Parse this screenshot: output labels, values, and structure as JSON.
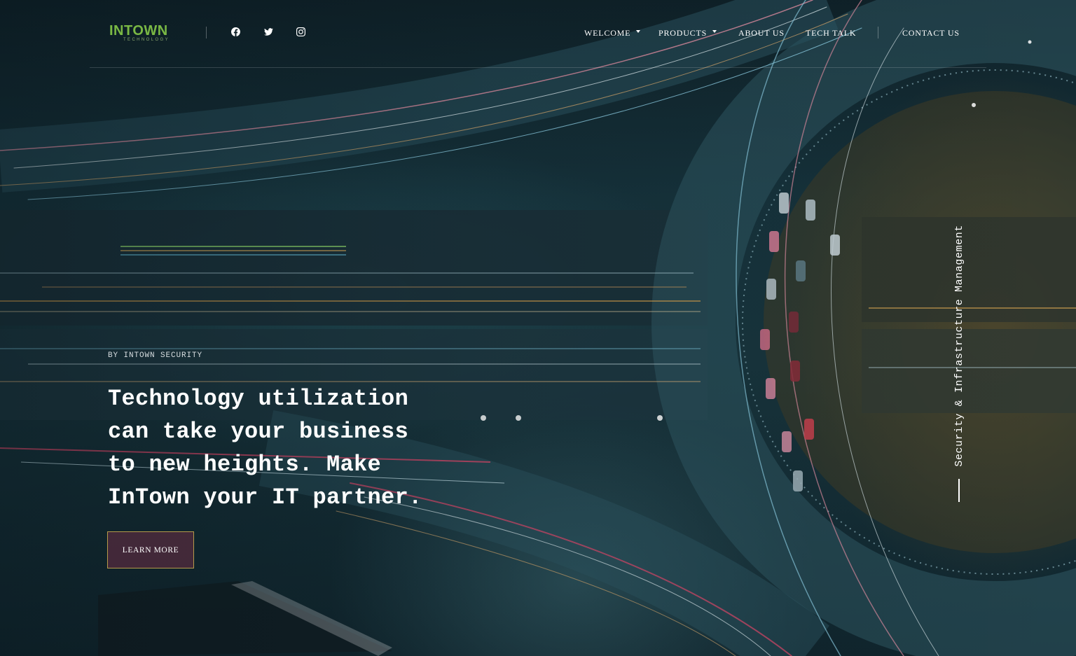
{
  "header": {
    "logo": {
      "word": "INTOWN",
      "sub": "TECHNOLOGY"
    },
    "social": [
      {
        "icon": "facebook-icon"
      },
      {
        "icon": "twitter-icon"
      },
      {
        "icon": "instagram-icon"
      }
    ],
    "nav": {
      "welcome": "WELCOME",
      "products": "PRODUCTS",
      "about": "ABOUT US",
      "tech_talk": "TECH TALK",
      "contact": "CONTACT US"
    }
  },
  "hero": {
    "eyebrow": "BY INTOWN SECURITY",
    "headline": "Technology utilization can take your business to new heights. Make InTown your IT partner.",
    "cta": "LEARN MORE",
    "side_tag": "Security & Infrastructure Management"
  },
  "colors": {
    "logo_green": "#7ab844",
    "cta_border": "#b59a4a",
    "cta_fill": "#6e2d46"
  }
}
